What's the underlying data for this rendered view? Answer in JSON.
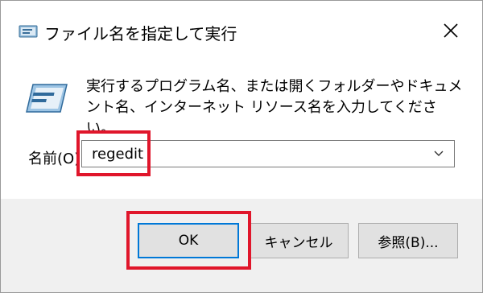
{
  "window": {
    "title": "ファイル名を指定して実行",
    "title_icon": "run-dialog-icon",
    "close_icon": "close-icon"
  },
  "content": {
    "icon": "run-program-icon",
    "description": "実行するプログラム名、または開くフォルダーやドキュメント名、インターネット リソース名を入力してください。",
    "name_label": "名前(O):",
    "input_value": "regedit",
    "dropdown_icon": "chevron-down-icon"
  },
  "buttons": {
    "ok_label": "OK",
    "cancel_label": "キャンセル",
    "browse_label": "参照(B)..."
  },
  "colors": {
    "highlight": "#e0162b",
    "default_button_border": "#0078d7",
    "footer_background": "#f0f0f0"
  }
}
